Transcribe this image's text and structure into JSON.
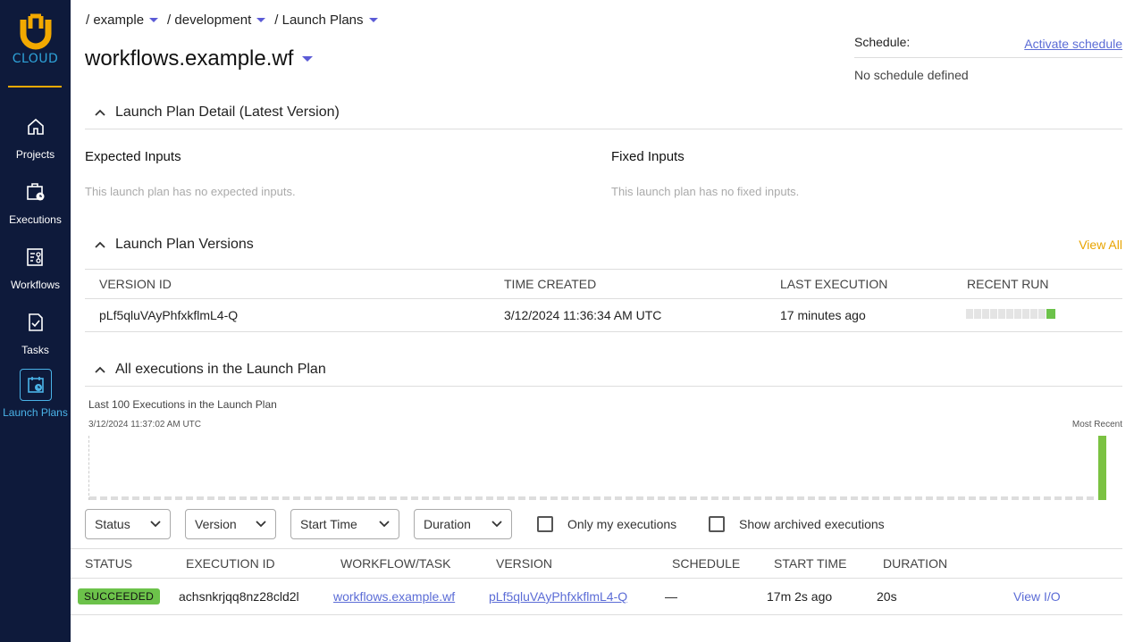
{
  "sidebar": {
    "logo_text": "CLOUD",
    "items": [
      {
        "label": "Projects"
      },
      {
        "label": "Executions"
      },
      {
        "label": "Workflows"
      },
      {
        "label": "Tasks"
      },
      {
        "label": "Launch Plans"
      }
    ],
    "active_index": 4
  },
  "breadcrumb": [
    "/ example",
    "/ development",
    "/ Launch Plans"
  ],
  "page_title": "workflows.example.wf",
  "schedule": {
    "label": "Schedule:",
    "action": "Activate schedule",
    "value": "No schedule defined"
  },
  "detail": {
    "title": "Launch Plan Detail (Latest Version)",
    "expected_title": "Expected Inputs",
    "expected_empty": "This launch plan has no expected inputs.",
    "fixed_title": "Fixed Inputs",
    "fixed_empty": "This launch plan has no fixed inputs."
  },
  "versions": {
    "title": "Launch Plan Versions",
    "view_all": "View All",
    "columns": [
      "VERSION ID",
      "TIME CREATED",
      "LAST EXECUTION",
      "RECENT RUN"
    ],
    "rows": [
      {
        "version_id": "pLf5qluVAyPhfxkflmL4-Q",
        "time_created": "3/12/2024 11:36:34 AM UTC",
        "last_execution": "17 minutes ago",
        "recent_runs_empty": 10,
        "recent_runs_success": 1
      }
    ]
  },
  "executions": {
    "title": "All executions in the Launch Plan",
    "chart_title": "Last 100 Executions in the Launch Plan",
    "chart_start": "3/12/2024 11:37:02 AM UTC",
    "chart_end": "Most Recent",
    "filters": [
      "Status",
      "Version",
      "Start Time",
      "Duration"
    ],
    "checkboxes": [
      "Only my executions",
      "Show archived executions"
    ],
    "columns": [
      "STATUS",
      "EXECUTION ID",
      "WORKFLOW/TASK",
      "VERSION",
      "SCHEDULE",
      "START TIME",
      "DURATION"
    ],
    "rows": [
      {
        "status": "SUCCEEDED",
        "execution_id": "achsnkrjqq8nz28cld2l",
        "workflow": "workflows.example.wf",
        "version": "pLf5qluVAyPhfxkflmL4-Q",
        "schedule": "—",
        "start_time": "17m 2s ago",
        "duration": "20s",
        "action": "View I/O"
      }
    ]
  },
  "colors": {
    "sidebar_bg": "#0e1a3b",
    "accent_blue": "#4ab3e8",
    "logo_orange": "#f2a900",
    "success_green": "#6cc24a",
    "link_blue": "#5b6cd6",
    "view_all_orange": "#e8a400"
  }
}
